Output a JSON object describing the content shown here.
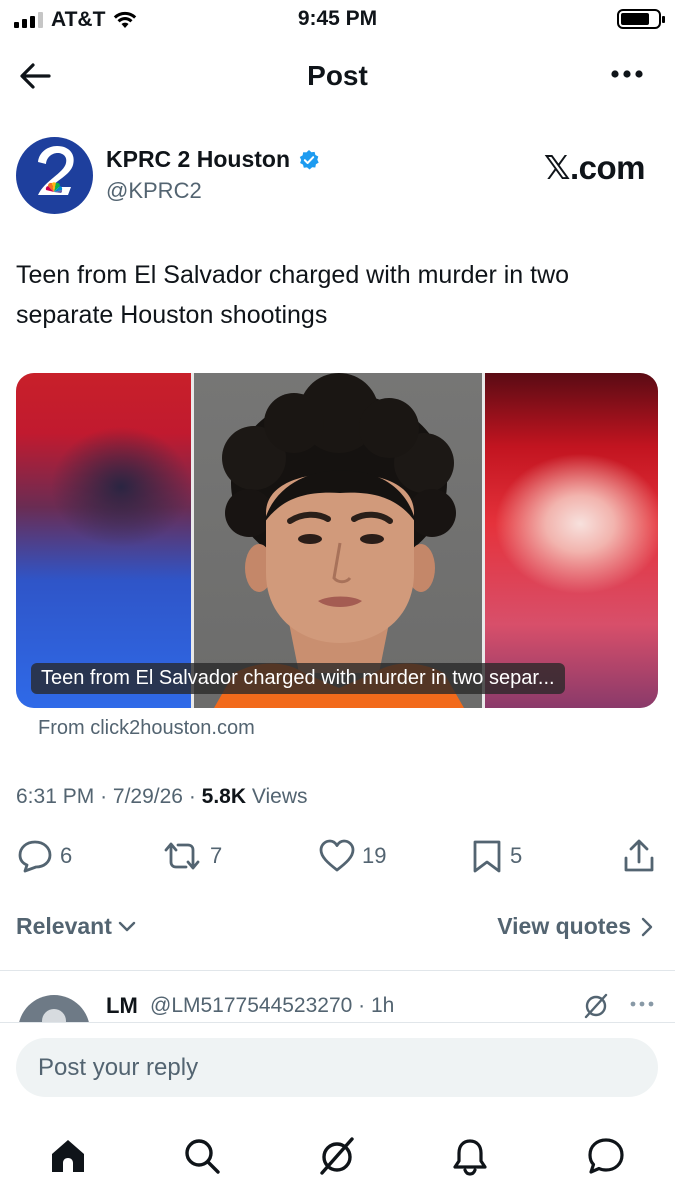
{
  "status_bar": {
    "carrier": "AT&T",
    "time": "9:45 PM"
  },
  "header": {
    "title": "Post",
    "back_icon": "arrow-left-icon",
    "more_icon": "more-horizontal-icon"
  },
  "post": {
    "author_name": "KPRC 2 Houston",
    "author_handle": "@KPRC2",
    "verified": true,
    "source_brand": "𝕏.com",
    "text": "Teen from El Salvador charged with murder in two separate Houston shootings",
    "card": {
      "caption": "Teen from El Salvador charged with murder in two separ...",
      "source": "From click2houston.com"
    },
    "time": "6:31 PM",
    "date": "7/29/26",
    "views_count": "5.8K",
    "views_label": "Views",
    "counts": {
      "replies": "6",
      "reposts": "7",
      "likes": "19",
      "bookmarks": "5"
    }
  },
  "replies_bar": {
    "sort_label": "Relevant",
    "quotes_label": "View quotes"
  },
  "reply_preview": {
    "name": "LM",
    "handle": "@LM5177544523270",
    "time": "1h"
  },
  "reply_input": {
    "placeholder": "Post your reply"
  },
  "colors": {
    "accent": "#1d9bf0",
    "secondary_text": "#536471",
    "primary_text": "#0f1419"
  },
  "tab_bar": [
    "home-icon",
    "search-icon",
    "grok-icon",
    "notifications-icon",
    "messages-icon"
  ]
}
